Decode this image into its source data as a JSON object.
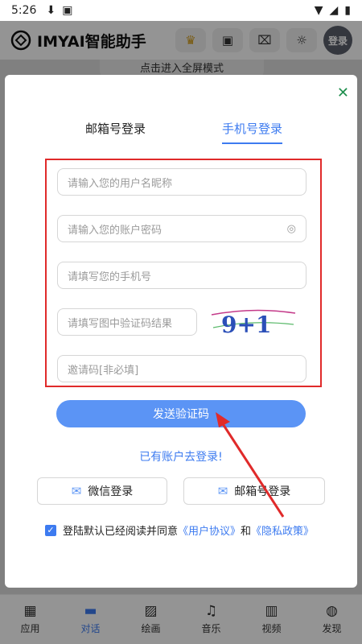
{
  "status": {
    "time": "5:26"
  },
  "app": {
    "title": "IMYAI智能助手",
    "login_label": "登录",
    "fullscreen_hint": "点击进入全屏模式"
  },
  "modal": {
    "tabs": [
      "邮箱号登录",
      "手机号登录"
    ],
    "active_tab": "手机号登录",
    "fields": {
      "username_placeholder": "请输入您的用户名昵称",
      "password_placeholder": "请输入您的账户密码",
      "phone_placeholder": "请填写您的手机号",
      "captcha_placeholder": "请填写图中验证码结果",
      "invite_placeholder": "邀请码[非必填]"
    },
    "captcha_text": "9+1",
    "send_button": "发送验证码",
    "has_account_link": "已有账户去登录!",
    "wechat_login": "微信登录",
    "email_login": "邮箱号登录",
    "agreement": {
      "prefix": "登陆默认已经阅读并同意",
      "user_agreement": "《用户协议》",
      "and": "和",
      "privacy_policy": "《隐私政策》"
    }
  },
  "bottom_nav": [
    {
      "label": "应用",
      "icon": "app-icon"
    },
    {
      "label": "对话",
      "icon": "chat-icon"
    },
    {
      "label": "绘画",
      "icon": "image-icon"
    },
    {
      "label": "音乐",
      "icon": "music-icon"
    },
    {
      "label": "视频",
      "icon": "video-icon"
    },
    {
      "label": "发现",
      "icon": "planet-icon"
    }
  ],
  "active_nav": "对话",
  "colors": {
    "accent": "#3d7bf0",
    "highlight_box": "#e02a2a",
    "button": "#5b94f5"
  }
}
